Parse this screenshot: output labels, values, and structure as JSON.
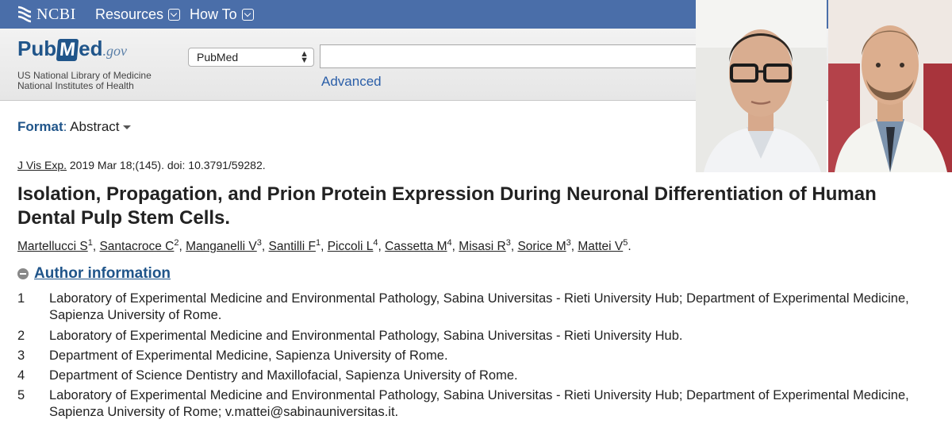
{
  "ncbi_bar": {
    "logo_text": "NCBI",
    "menus": [
      {
        "label": "Resources"
      },
      {
        "label": "How To"
      }
    ]
  },
  "pubmed_header": {
    "logo": {
      "pub": "Pub",
      "med": "M",
      "ed": "ed",
      "gov": ".gov"
    },
    "nlm_line1": "US National Library of Medicine",
    "nlm_line2": "National Institutes of Health",
    "database_select": "PubMed",
    "search_value": "",
    "advanced_label": "Advanced"
  },
  "format": {
    "label": "Format",
    "separator": ":",
    "value": "Abstract"
  },
  "citation": {
    "journal": "J Vis Exp.",
    "details": "2019 Mar 18;(145). doi: 10.3791/59282."
  },
  "article_title": "Isolation, Propagation, and Prion Protein Expression During Neuronal Differentiation of Human Dental Pulp Stem Cells.",
  "authors": [
    {
      "name": "Martellucci S",
      "aff": "1"
    },
    {
      "name": "Santacroce C",
      "aff": "2"
    },
    {
      "name": "Manganelli V",
      "aff": "3"
    },
    {
      "name": "Santilli F",
      "aff": "1"
    },
    {
      "name": "Piccoli L",
      "aff": "4"
    },
    {
      "name": "Cassetta M",
      "aff": "4"
    },
    {
      "name": "Misasi R",
      "aff": "3"
    },
    {
      "name": "Sorice M",
      "aff": "3"
    },
    {
      "name": "Mattei V",
      "aff": "5"
    }
  ],
  "author_info": {
    "toggle_label": "Author information",
    "affiliations": [
      {
        "num": "1",
        "text": "Laboratory of Experimental Medicine and Environmental Pathology, Sabina Universitas - Rieti University Hub; Department of Experimental Medicine, Sapienza University of Rome."
      },
      {
        "num": "2",
        "text": "Laboratory of Experimental Medicine and Environmental Pathology, Sabina Universitas - Rieti University Hub."
      },
      {
        "num": "3",
        "text": "Department of Experimental Medicine, Sapienza University of Rome."
      },
      {
        "num": "4",
        "text": "Department of Science Dentistry and Maxillofacial, Sapienza University of Rome."
      },
      {
        "num": "5",
        "text": "Laboratory of Experimental Medicine and Environmental Pathology, Sabina Universitas - Rieti University Hub; Department of Experimental Medicine, Sapienza University of Rome; v.mattei@sabinauniversitas.it."
      }
    ]
  },
  "colors": {
    "ncbi_bar": "#4a6ea9",
    "link_blue": "#20558a",
    "advanced_blue": "#2a5ea8"
  }
}
